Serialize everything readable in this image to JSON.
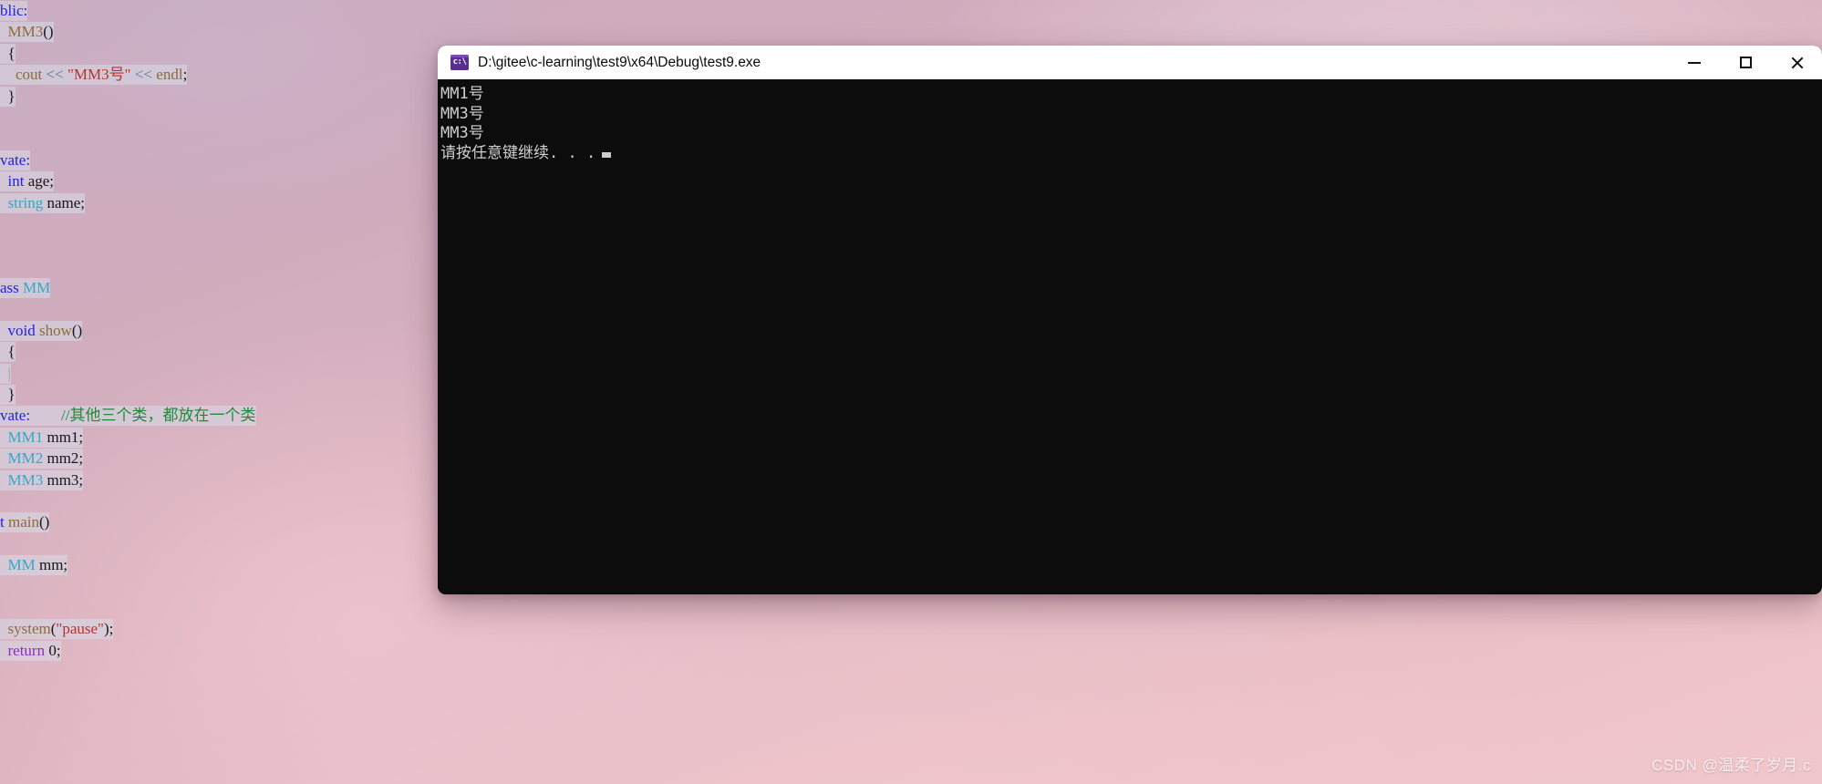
{
  "desktop": {
    "wallpaper_colors": [
      "#c9aabe",
      "#d9b2bf",
      "#eec3c8",
      "#f0c8cb"
    ],
    "watermark": "CSDN @温柔了岁月.c"
  },
  "editor": {
    "name": "code-editor-background",
    "lines": [
      {
        "indent": 0,
        "tokens": [
          {
            "t": "blic:",
            "c": "kw"
          }
        ]
      },
      {
        "indent": 0,
        "tokens": [
          {
            "t": "  ",
            "c": "plain"
          },
          {
            "t": "MM3",
            "c": "fn"
          },
          {
            "t": "()",
            "c": "plain"
          }
        ]
      },
      {
        "indent": 0,
        "tokens": [
          {
            "t": "  {",
            "c": "plain"
          }
        ]
      },
      {
        "indent": 0,
        "tokens": [
          {
            "t": "    ",
            "c": "plain"
          },
          {
            "t": "cout",
            "c": "fn"
          },
          {
            "t": " ",
            "c": "plain"
          },
          {
            "t": "<<",
            "c": "op"
          },
          {
            "t": " ",
            "c": "plain"
          },
          {
            "t": "\"MM3号\"",
            "c": "str"
          },
          {
            "t": " ",
            "c": "plain"
          },
          {
            "t": "<<",
            "c": "op"
          },
          {
            "t": " ",
            "c": "plain"
          },
          {
            "t": "endl",
            "c": "fn"
          },
          {
            "t": ";",
            "c": "plain"
          }
        ]
      },
      {
        "indent": 0,
        "tokens": [
          {
            "t": "  }",
            "c": "plain"
          }
        ]
      },
      {
        "indent": 0,
        "tokens": []
      },
      {
        "indent": 0,
        "tokens": []
      },
      {
        "indent": 0,
        "tokens": [
          {
            "t": "vate:",
            "c": "kw"
          }
        ]
      },
      {
        "indent": 0,
        "tokens": [
          {
            "t": "  ",
            "c": "plain"
          },
          {
            "t": "int",
            "c": "kw"
          },
          {
            "t": " age;",
            "c": "plain"
          }
        ]
      },
      {
        "indent": 0,
        "tokens": [
          {
            "t": "  ",
            "c": "plain"
          },
          {
            "t": "string",
            "c": "type"
          },
          {
            "t": " name;",
            "c": "plain"
          }
        ]
      },
      {
        "indent": 0,
        "tokens": []
      },
      {
        "indent": 0,
        "tokens": []
      },
      {
        "indent": 0,
        "tokens": []
      },
      {
        "indent": 0,
        "tokens": [
          {
            "t": "ass ",
            "c": "kw"
          },
          {
            "t": "MM",
            "c": "type"
          }
        ]
      },
      {
        "indent": 0,
        "tokens": []
      },
      {
        "indent": 0,
        "tokens": [
          {
            "t": "  ",
            "c": "plain"
          },
          {
            "t": "void",
            "c": "kw"
          },
          {
            "t": " ",
            "c": "plain"
          },
          {
            "t": "show",
            "c": "fn"
          },
          {
            "t": "()",
            "c": "plain"
          }
        ]
      },
      {
        "indent": 0,
        "tokens": [
          {
            "t": "  {",
            "c": "plain"
          }
        ]
      },
      {
        "indent": 0,
        "tokens": [
          {
            "t": "  ",
            "c": "plain"
          },
          {
            "t": "|",
            "c": "guide"
          }
        ]
      },
      {
        "indent": 0,
        "tokens": [
          {
            "t": "  }",
            "c": "plain"
          }
        ]
      },
      {
        "indent": 0,
        "tokens": [
          {
            "t": "vate:",
            "c": "kw"
          },
          {
            "t": "        ",
            "c": "plain"
          },
          {
            "t": "//其他三个类，都放在一个类",
            "c": "comment"
          }
        ]
      },
      {
        "indent": 0,
        "tokens": [
          {
            "t": "  ",
            "c": "plain"
          },
          {
            "t": "MM1",
            "c": "type"
          },
          {
            "t": " mm1;",
            "c": "plain"
          }
        ]
      },
      {
        "indent": 0,
        "tokens": [
          {
            "t": "  ",
            "c": "plain"
          },
          {
            "t": "MM2",
            "c": "type"
          },
          {
            "t": " mm2;",
            "c": "plain"
          }
        ]
      },
      {
        "indent": 0,
        "tokens": [
          {
            "t": "  ",
            "c": "plain"
          },
          {
            "t": "MM3",
            "c": "type"
          },
          {
            "t": " mm3;",
            "c": "plain"
          }
        ]
      },
      {
        "indent": 0,
        "tokens": []
      },
      {
        "indent": 0,
        "tokens": [
          {
            "t": "t ",
            "c": "kw"
          },
          {
            "t": "main",
            "c": "fn"
          },
          {
            "t": "()",
            "c": "plain"
          }
        ]
      },
      {
        "indent": 0,
        "tokens": []
      },
      {
        "indent": 0,
        "tokens": [
          {
            "t": "  ",
            "c": "plain"
          },
          {
            "t": "MM",
            "c": "type"
          },
          {
            "t": " mm;",
            "c": "plain"
          }
        ]
      },
      {
        "indent": 0,
        "tokens": []
      },
      {
        "indent": 0,
        "tokens": []
      },
      {
        "indent": 0,
        "tokens": [
          {
            "t": "  ",
            "c": "plain"
          },
          {
            "t": "system",
            "c": "fn"
          },
          {
            "t": "(",
            "c": "plain"
          },
          {
            "t": "\"pause\"",
            "c": "str"
          },
          {
            "t": ");",
            "c": "plain"
          }
        ]
      },
      {
        "indent": 0,
        "tokens": [
          {
            "t": "  ",
            "c": "plain"
          },
          {
            "t": "return",
            "c": "kw-pur"
          },
          {
            "t": " ",
            "c": "plain"
          },
          {
            "t": "0",
            "c": "num"
          },
          {
            "t": ";",
            "c": "plain"
          }
        ]
      }
    ],
    "syntax_colors": {
      "keyword": "#2222e0",
      "keyword_purple": "#8c2fbf",
      "type": "#36a7c8",
      "function": "#8a6d3b",
      "string": "#b5342c",
      "operator": "#4f7f8f",
      "comment": "#1e8a3c",
      "plain": "#16161b"
    }
  },
  "console": {
    "title": "D:\\gitee\\c-learning\\test9\\x64\\Debug\\test9.exe",
    "icon": "console-cmd-icon",
    "icon_glyph": "c:\\",
    "icon_color": "#5c2d91",
    "titlebar_background": "#ffffff",
    "background": "#0c0c0c",
    "text_color": "#cfcfcf",
    "controls": {
      "minimize_label": "—",
      "maximize_label": "□",
      "close_label": "✕"
    },
    "output_lines": [
      "MM1号",
      "MM3号",
      "MM3号",
      "请按任意键继续. . ."
    ]
  }
}
